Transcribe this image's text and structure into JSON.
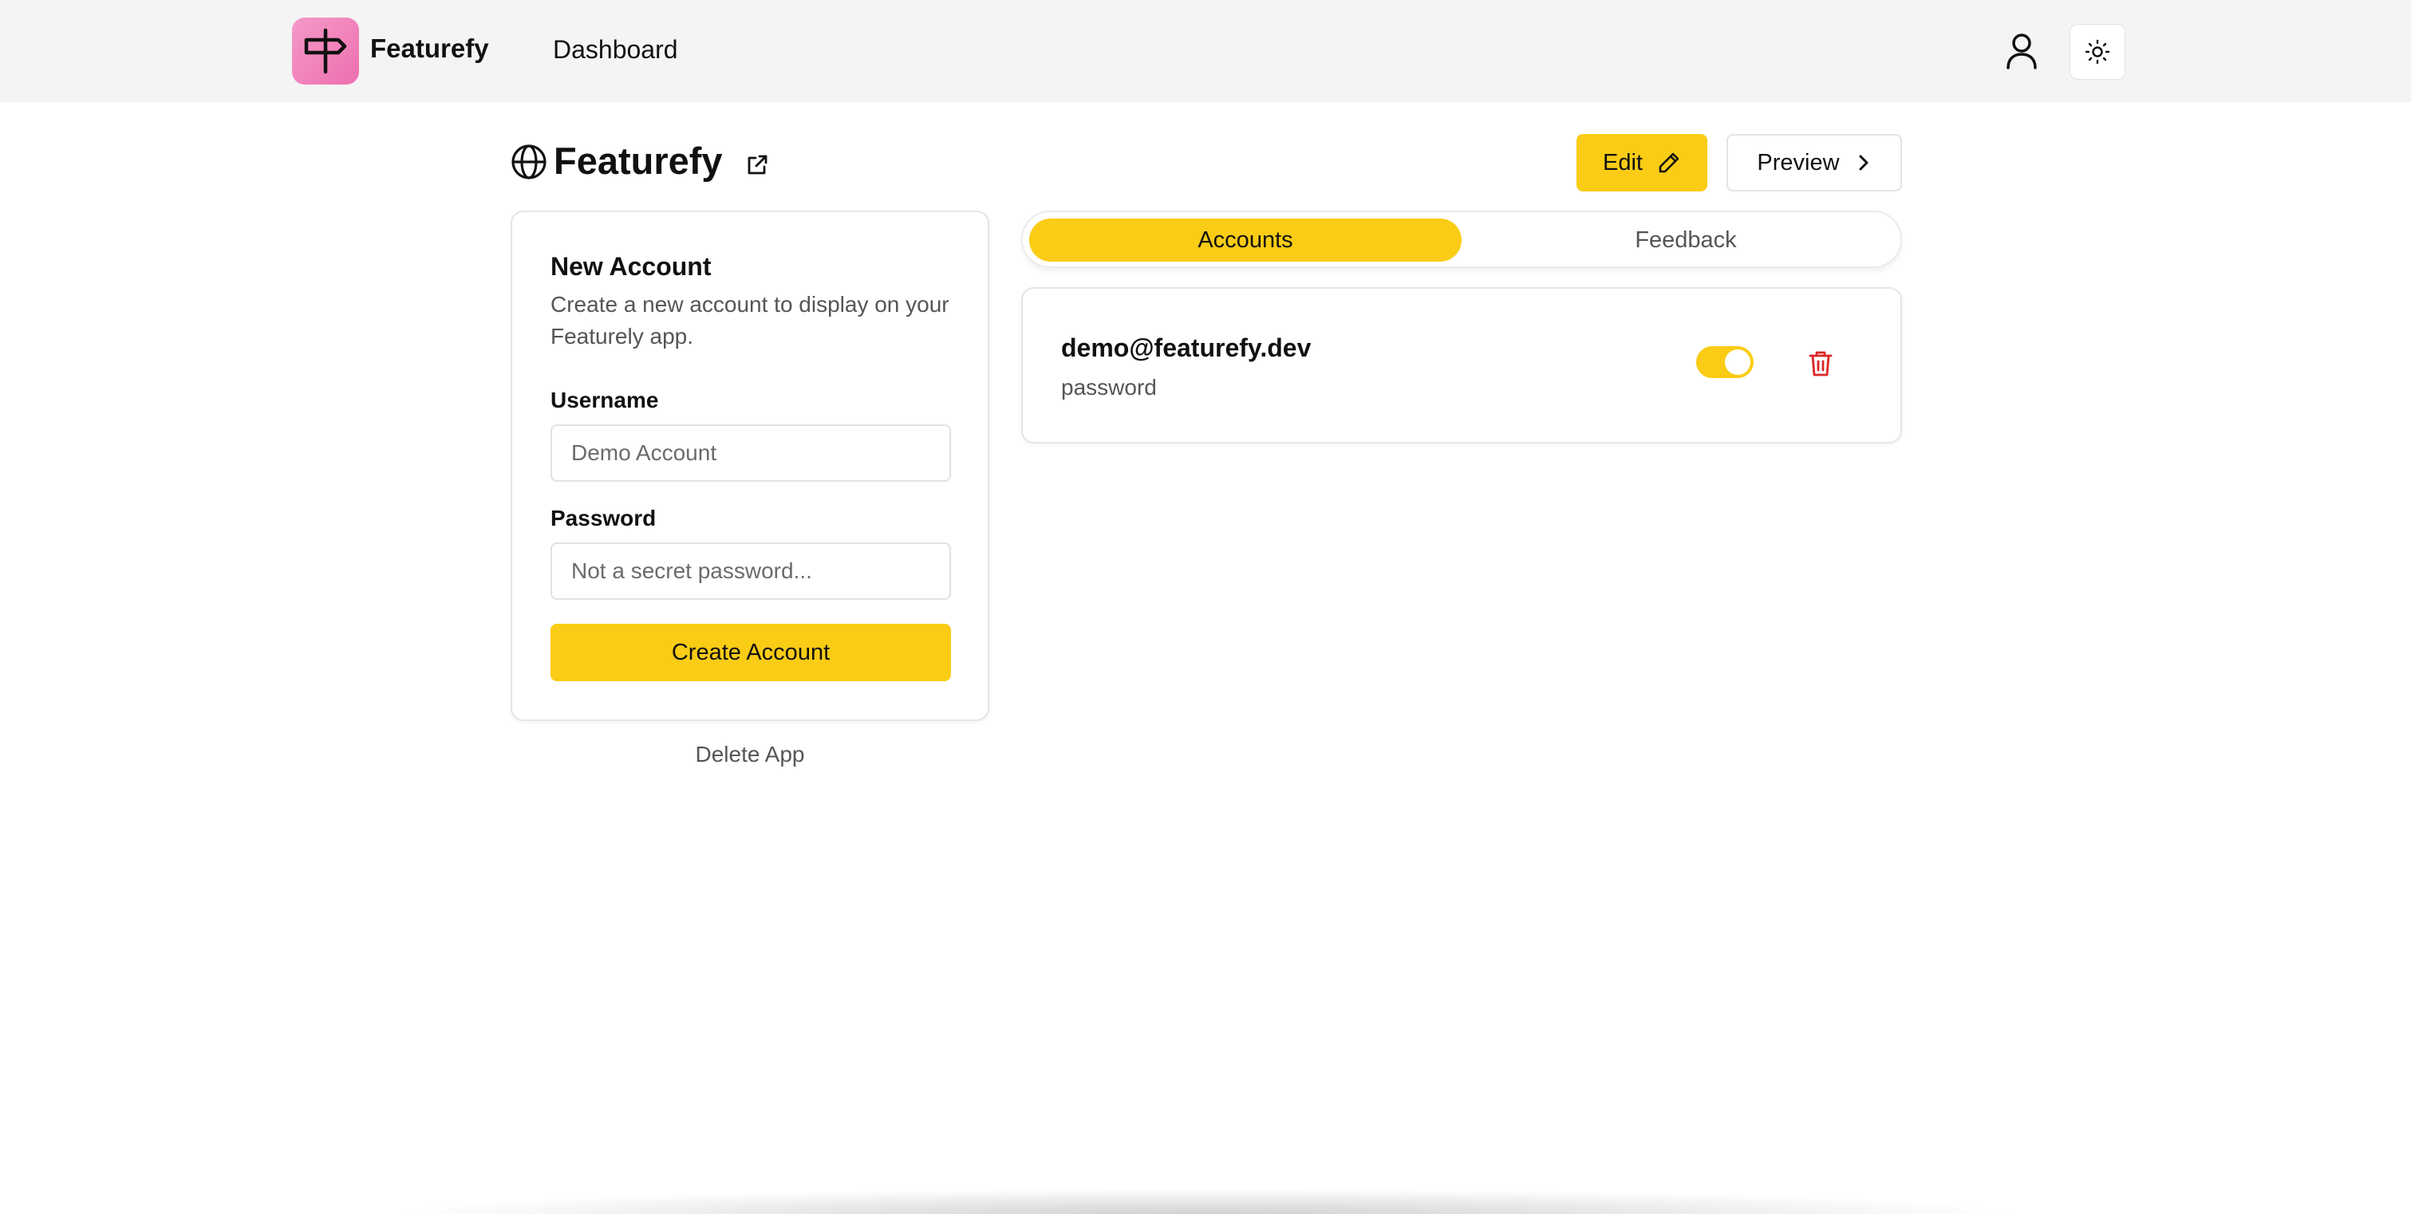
{
  "header": {
    "brand": "Featurefy",
    "nav_dashboard": "Dashboard",
    "user_icon": "user-icon",
    "theme_icon": "sun-icon"
  },
  "app": {
    "title": "Featurefy",
    "title_icon": "globe-icon",
    "external_icon": "external-link-icon",
    "edit_label": "Edit",
    "preview_label": "Preview"
  },
  "new_account": {
    "heading": "New Account",
    "description": "Create a new account to display on your Featurely app.",
    "username_label": "Username",
    "username_placeholder": "Demo Account",
    "password_label": "Password",
    "password_placeholder": "Not a secret password...",
    "create_label": "Create Account"
  },
  "delete_app_label": "Delete App",
  "tabs": [
    {
      "label": "Accounts",
      "active": true
    },
    {
      "label": "Feedback",
      "active": false
    }
  ],
  "accounts": [
    {
      "username": "demo@featurefy.dev",
      "password": "password",
      "enabled": true
    }
  ],
  "colors": {
    "accent": "#facc15",
    "logo_pink": "#ee6fae",
    "danger": "#dc2626"
  }
}
